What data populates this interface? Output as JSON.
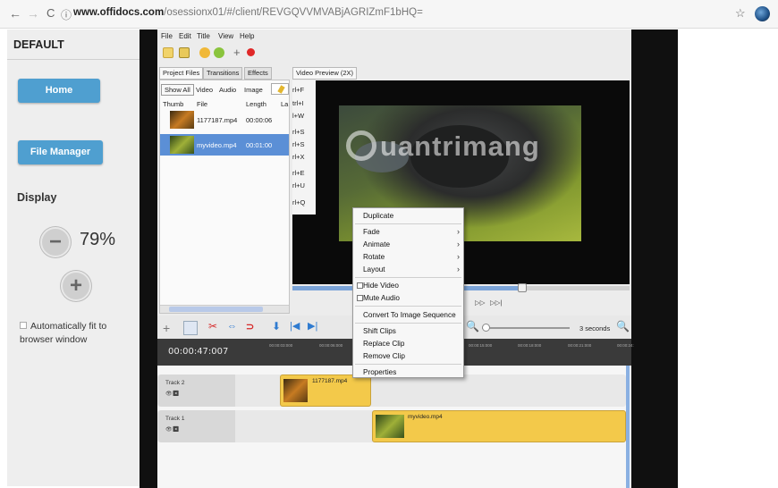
{
  "browser": {
    "back": "←",
    "forward": "→",
    "reload": "C",
    "info": "ⓘ",
    "url_domain": "www.offidocs.com",
    "url_rest": "/osessionx01/#/client/REVGQVVMVABjAGRIZmF1bHQ=",
    "star": "☆"
  },
  "sidebar": {
    "title": "DEFAULT",
    "home_label": "Home",
    "file_manager_label": "File Manager",
    "display_label": "Display",
    "zoom_value": "79%",
    "minus": "−",
    "plus": "+",
    "autofit_label": "Automatically fit to browser window"
  },
  "app": {
    "menu": [
      "File",
      "Edit",
      "Title",
      "View",
      "Help"
    ],
    "left_tabs": [
      "Project Files",
      "Transitions",
      "Effects"
    ],
    "filter_buttons": [
      "Show All",
      "Video",
      "Audio",
      "Image"
    ],
    "file_columns": [
      "Thumb",
      "File",
      "Length",
      "La"
    ],
    "files": [
      {
        "name": "1177187.mp4",
        "length": "00:00:06"
      },
      {
        "name": "myvideo.mp4",
        "length": "00:01:00"
      }
    ],
    "preview_tab": "Video Preview (2X)",
    "shortcuts": [
      "rl+F",
      "trl+I",
      "l+W",
      "rl+S",
      "rl+S",
      "rl+X",
      "rl+E",
      "rl+U",
      "rl+Q"
    ],
    "playback": [
      "▷▷",
      "▷▷|"
    ],
    "timecode": "00:00:47:007",
    "zoom_label": "3 seconds",
    "ruler_ticks": [
      "00:00:03:000",
      "00:00:06:000",
      "00:00:15:000",
      "00:00:18:000",
      "00:00:21:000",
      "00:00:24:"
    ],
    "tracks": [
      {
        "name": "Track 2",
        "clip": "1177187.mp4"
      },
      {
        "name": "Track 1",
        "clip": "myvideo.mp4"
      }
    ],
    "context_menu": {
      "duplicate": "Duplicate",
      "fade": "Fade",
      "animate": "Animate",
      "rotate": "Rotate",
      "layout": "Layout",
      "hide_video": "Hide Video",
      "mute_audio": "Mute Audio",
      "convert": "Convert To Image Sequence",
      "shift_clips": "Shift Clips",
      "replace_clip": "Replace Clip",
      "remove_clip": "Remove Clip",
      "properties": "Properties"
    },
    "watermark": "uantrimang"
  },
  "colors": {
    "accent": "#4f9fd0",
    "clip": "#f3c94a",
    "selection": "#5b8fd6"
  }
}
